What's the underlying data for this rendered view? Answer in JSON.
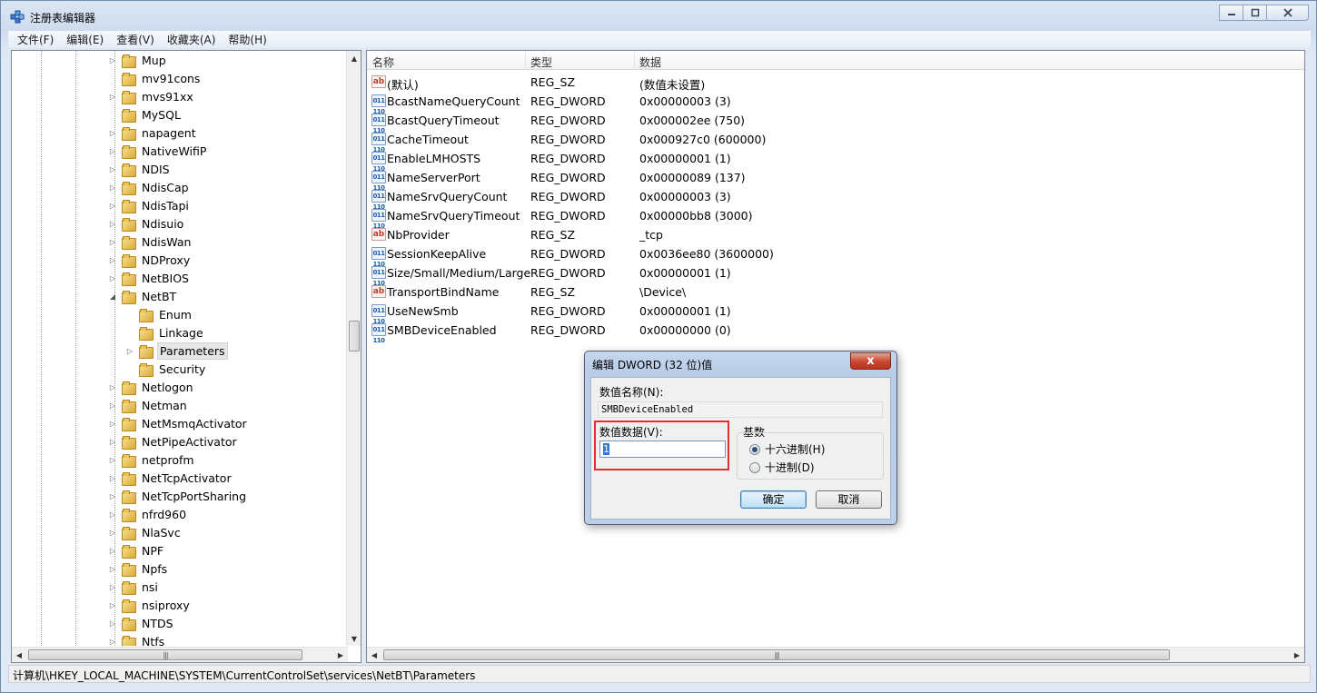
{
  "window": {
    "title": "注册表编辑器",
    "buttons": {
      "minimize": "—",
      "maximize": "▢",
      "close": "✕"
    }
  },
  "menu": [
    "文件(F)",
    "编辑(E)",
    "查看(V)",
    "收藏夹(A)",
    "帮助(H)"
  ],
  "tree": {
    "items": [
      {
        "label": "Mup",
        "expandable": true
      },
      {
        "label": "mv91cons",
        "expandable": false
      },
      {
        "label": "mvs91xx",
        "expandable": true
      },
      {
        "label": "MySQL",
        "expandable": false
      },
      {
        "label": "napagent",
        "expandable": true
      },
      {
        "label": "NativeWifiP",
        "expandable": true
      },
      {
        "label": "NDIS",
        "expandable": true
      },
      {
        "label": "NdisCap",
        "expandable": true
      },
      {
        "label": "NdisTapi",
        "expandable": true
      },
      {
        "label": "Ndisuio",
        "expandable": true
      },
      {
        "label": "NdisWan",
        "expandable": true
      },
      {
        "label": "NDProxy",
        "expandable": true
      },
      {
        "label": "NetBIOS",
        "expandable": true
      },
      {
        "label": "NetBT",
        "expandable": true,
        "expanded": true
      },
      {
        "label": "Enum",
        "expandable": false,
        "child": true
      },
      {
        "label": "Linkage",
        "expandable": false,
        "child": true
      },
      {
        "label": "Parameters",
        "expandable": true,
        "child": true,
        "selected": true
      },
      {
        "label": "Security",
        "expandable": false,
        "child": true
      },
      {
        "label": "Netlogon",
        "expandable": true
      },
      {
        "label": "Netman",
        "expandable": true
      },
      {
        "label": "NetMsmqActivator",
        "expandable": true
      },
      {
        "label": "NetPipeActivator",
        "expandable": true
      },
      {
        "label": "netprofm",
        "expandable": true
      },
      {
        "label": "NetTcpActivator",
        "expandable": true
      },
      {
        "label": "NetTcpPortSharing",
        "expandable": true
      },
      {
        "label": "nfrd960",
        "expandable": true
      },
      {
        "label": "NlaSvc",
        "expandable": true
      },
      {
        "label": "NPF",
        "expandable": true
      },
      {
        "label": "Npfs",
        "expandable": true
      },
      {
        "label": "nsi",
        "expandable": true
      },
      {
        "label": "nsiproxy",
        "expandable": true
      },
      {
        "label": "NTDS",
        "expandable": true
      },
      {
        "label": "Ntfs",
        "expandable": true
      }
    ]
  },
  "list": {
    "columns": [
      "名称",
      "类型",
      "数据"
    ],
    "rows": [
      {
        "name": "(默认)",
        "type": "REG_SZ",
        "data": "(数值未设置)",
        "icon": "string-value-icon"
      },
      {
        "name": "BcastNameQueryCount",
        "type": "REG_DWORD",
        "data": "0x00000003 (3)",
        "icon": "dword-value-icon"
      },
      {
        "name": "BcastQueryTimeout",
        "type": "REG_DWORD",
        "data": "0x000002ee (750)",
        "icon": "dword-value-icon"
      },
      {
        "name": "CacheTimeout",
        "type": "REG_DWORD",
        "data": "0x000927c0 (600000)",
        "icon": "dword-value-icon"
      },
      {
        "name": "EnableLMHOSTS",
        "type": "REG_DWORD",
        "data": "0x00000001 (1)",
        "icon": "dword-value-icon"
      },
      {
        "name": "NameServerPort",
        "type": "REG_DWORD",
        "data": "0x00000089 (137)",
        "icon": "dword-value-icon"
      },
      {
        "name": "NameSrvQueryCount",
        "type": "REG_DWORD",
        "data": "0x00000003 (3)",
        "icon": "dword-value-icon"
      },
      {
        "name": "NameSrvQueryTimeout",
        "type": "REG_DWORD",
        "data": "0x00000bb8 (3000)",
        "icon": "dword-value-icon"
      },
      {
        "name": "NbProvider",
        "type": "REG_SZ",
        "data": "_tcp",
        "icon": "string-value-icon"
      },
      {
        "name": "SessionKeepAlive",
        "type": "REG_DWORD",
        "data": "0x0036ee80 (3600000)",
        "icon": "dword-value-icon"
      },
      {
        "name": "Size/Small/Medium/Large",
        "type": "REG_DWORD",
        "data": "0x00000001 (1)",
        "icon": "dword-value-icon"
      },
      {
        "name": "TransportBindName",
        "type": "REG_SZ",
        "data": "\\Device\\",
        "icon": "string-value-icon"
      },
      {
        "name": "UseNewSmb",
        "type": "REG_DWORD",
        "data": "0x00000001 (1)",
        "icon": "dword-value-icon"
      },
      {
        "name": "SMBDeviceEnabled",
        "type": "REG_DWORD",
        "data": "0x00000000 (0)",
        "icon": "dword-value-icon"
      }
    ]
  },
  "icons": {
    "sz": "ab",
    "dword": "011 110"
  },
  "status": "计算机\\HKEY_LOCAL_MACHINE\\SYSTEM\\CurrentControlSet\\services\\NetBT\\Parameters",
  "dialog": {
    "title": "编辑 DWORD (32 位)值",
    "close": "x",
    "name_label": "数值名称(N):",
    "name_value": "SMBDeviceEnabled",
    "data_label": "数值数据(V):",
    "data_value": "1",
    "base_label": "基数",
    "hex_label": "十六进制(H)",
    "dec_label": "十进制(D)",
    "ok": "确定",
    "cancel": "取消"
  }
}
